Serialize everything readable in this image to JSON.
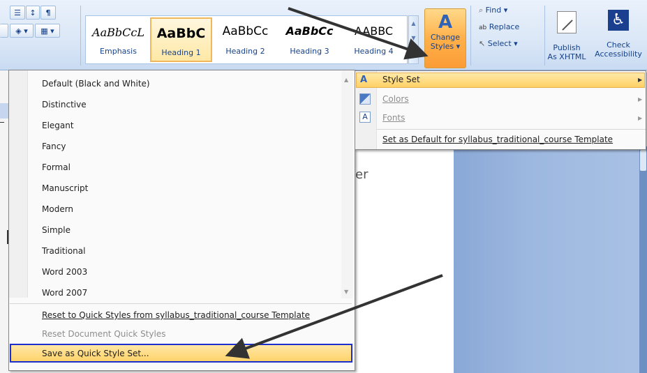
{
  "ribbon": {
    "paragraph": {
      "sort_icon": "sort-az-icon",
      "pilcrow_icon": "pilcrow-icon",
      "indent_icon": "indent-icon",
      "shading_icon": "paint-bucket-icon",
      "borders_icon": "borders-icon"
    },
    "styles_gallery": [
      {
        "sample": "AaBbCcL",
        "label": "Emphasis"
      },
      {
        "sample": "AaBbC",
        "label": "Heading 1",
        "selected": true
      },
      {
        "sample": "AaBbCc",
        "label": "Heading 2"
      },
      {
        "sample": "AaBbCc",
        "label": "Heading 3"
      },
      {
        "sample": "AABBC",
        "label": "Heading 4"
      }
    ],
    "change_styles": {
      "line1": "Change",
      "line2": "Styles"
    },
    "editing": {
      "find": "Find",
      "replace": "Replace",
      "select": "Select"
    },
    "publish": {
      "line1": "Publish",
      "line2": "As XHTML"
    },
    "check": {
      "line1": "Check",
      "line2": "Accessibility"
    }
  },
  "document": {
    "fragment": "ter"
  },
  "styleset_menu": {
    "items": [
      "Default (Black and White)",
      "Distinctive",
      "Elegant",
      "Fancy",
      "Formal",
      "Manuscript",
      "Modern",
      "Simple",
      "Traditional",
      "Word 2003",
      "Word 2007"
    ],
    "reset_template": "Reset to Quick Styles from syllabus_traditional_course Template",
    "reset_document": "Reset Document Quick Styles",
    "save": "Save as Quick Style Set..."
  },
  "submenu": {
    "style_set": "Style Set",
    "colors": "Colors",
    "fonts": "Fonts",
    "set_default": "Set as Default for syllabus_traditional_course Template"
  },
  "colors": {
    "highlight": "#ffd36a",
    "selection_border": "#1b2fcf",
    "accent_orange": "#fb9c36"
  }
}
